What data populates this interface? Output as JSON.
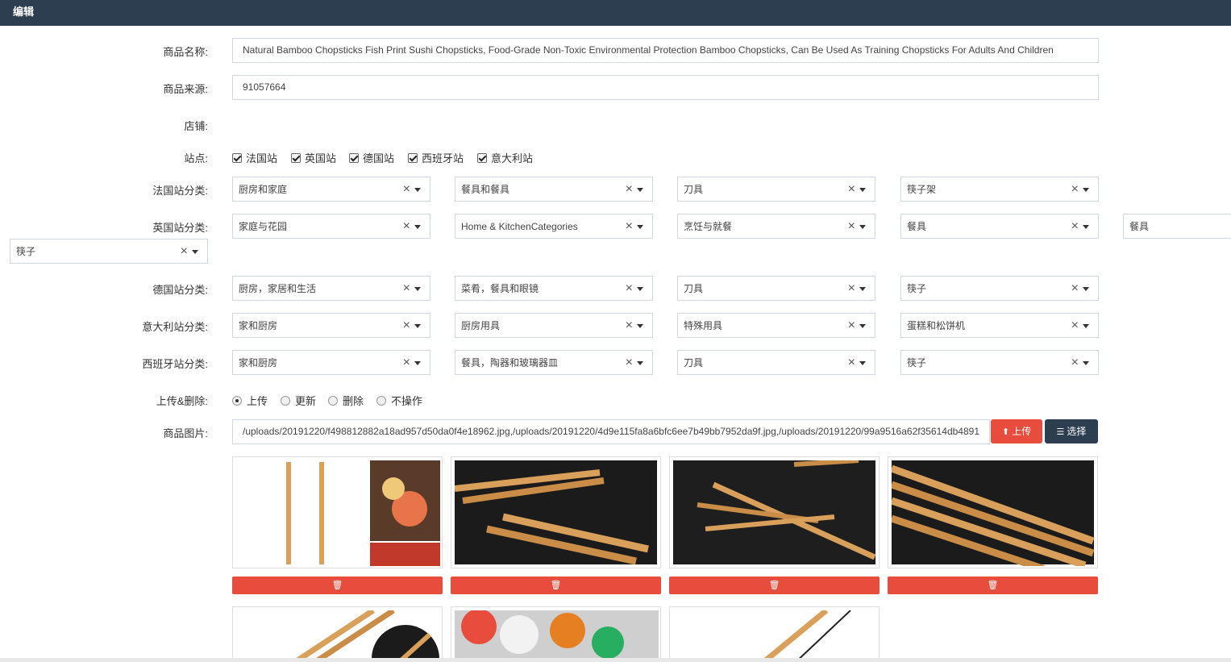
{
  "header": {
    "title": "编辑"
  },
  "labels": {
    "name": "商品名称:",
    "source": "商品来源:",
    "shop": "店铺:",
    "sites": "站点:",
    "fr_cat": "法国站分类:",
    "uk_cat": "英国站分类:",
    "de_cat": "德国站分类:",
    "it_cat": "意大利站分类:",
    "es_cat": "西班牙站分类:",
    "action": "上传&删除:",
    "images": "商品图片:"
  },
  "fields": {
    "name": "Natural Bamboo Chopsticks Fish Print Sushi Chopsticks, Food-Grade Non-Toxic Environmental Protection Bamboo Chopsticks, Can Be Used As Training Chopsticks For Adults And Children",
    "source": "91057664",
    "images": "/uploads/20191220/f498812882a18ad957d50da0f4e18962.jpg,/uploads/20191220/4d9e115fa8a6bfc6ee7b49bb7952da9f.jpg,/uploads/20191220/99a9516a62f35614db4891"
  },
  "sites": [
    "法国站",
    "英国站",
    "德国站",
    "西班牙站",
    "意大利站"
  ],
  "categories": {
    "fr": [
      "厨房和家庭",
      "餐具和餐具",
      "刀具",
      "筷子架"
    ],
    "uk": [
      "家庭与花园",
      "Home & KitchenCategories",
      "烹饪与就餐",
      "餐具",
      "餐具",
      "筷子"
    ],
    "de": [
      "厨房，家居和生活",
      "菜肴，餐具和眼镜",
      "刀具",
      "筷子"
    ],
    "it": [
      "家和厨房",
      "厨房用具",
      "特殊用具",
      "蛋糕和松饼机"
    ],
    "es": [
      "家和厨房",
      "餐具，陶器和玻璃器皿",
      "刀具",
      "筷子"
    ]
  },
  "select_clear": "×",
  "actions": [
    "上传",
    "更新",
    "删除",
    "不操作"
  ],
  "action_selected": "上传",
  "buttons": {
    "upload": "上传",
    "choose": "选择"
  },
  "delete_icon": "trash-icon",
  "colors": {
    "header": "#2c3e50",
    "danger": "#e74c3c",
    "dark_button": "#2c3e50"
  }
}
